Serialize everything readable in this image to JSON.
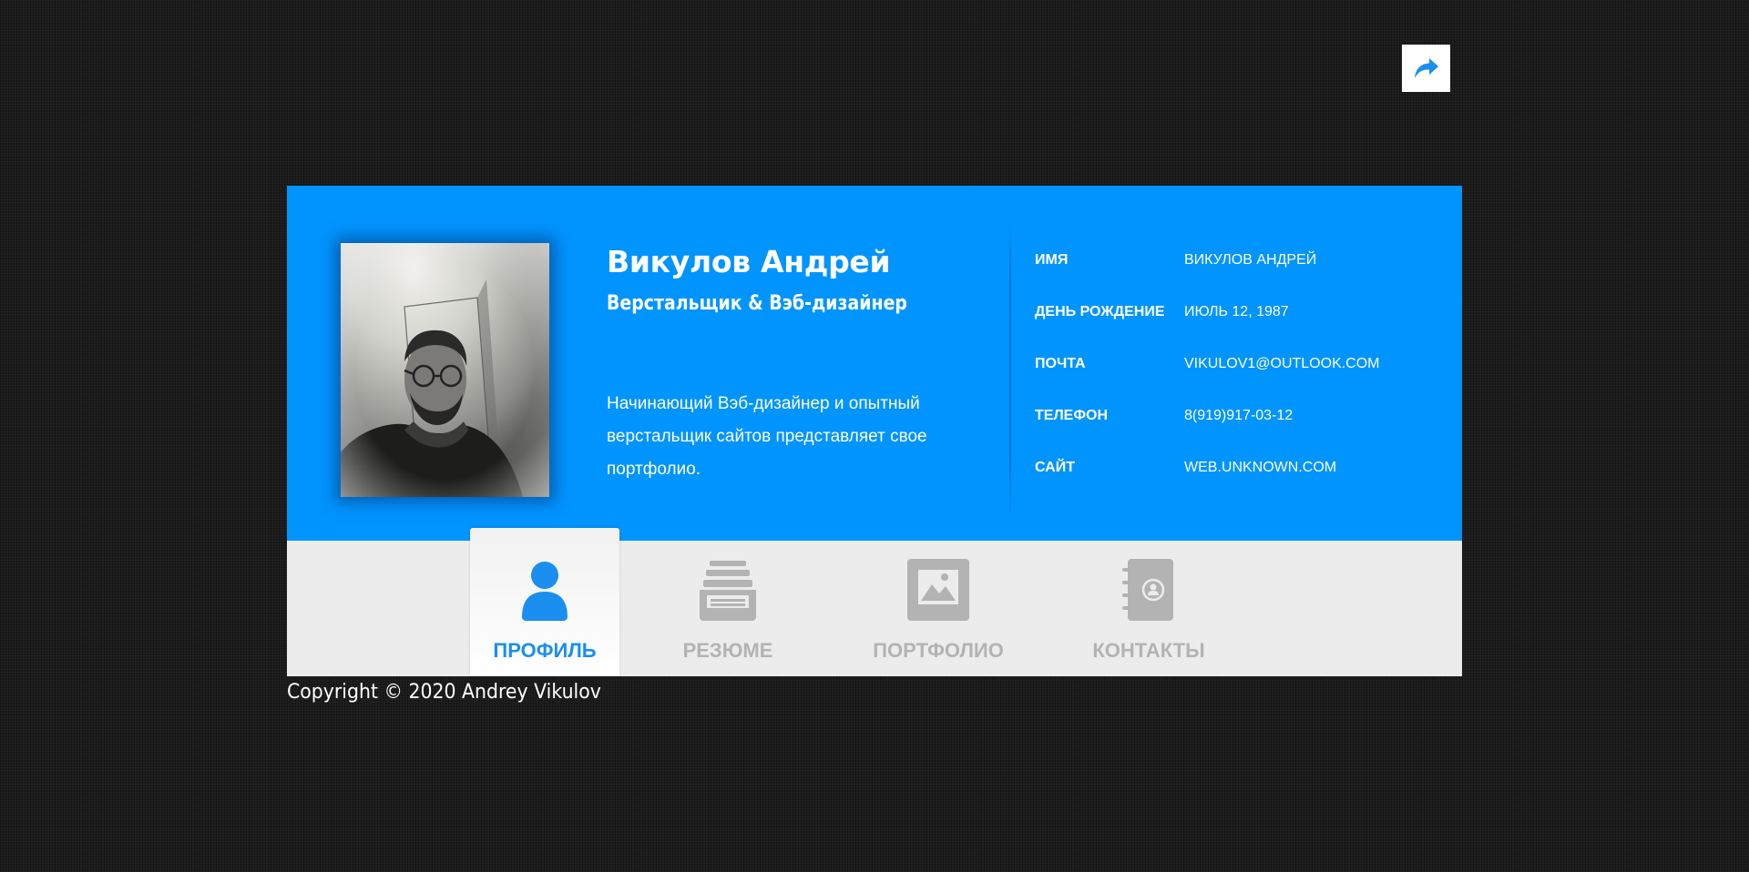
{
  "share": {
    "icon": "share-arrow-icon"
  },
  "profile": {
    "name": "Викулов Андрей",
    "role": "Верстальщик & Вэб-дизайнер",
    "bio": "Начинающий Вэб-дизайнер и опытный верстальщик сайтов представляет свое портфолио.",
    "photo": "portrait-photo"
  },
  "info": [
    {
      "label": "ИМЯ",
      "value": "ВИКУЛОВ АНДРЕЙ"
    },
    {
      "label": "ДЕНЬ РОЖДЕНИЕ",
      "value": "ИЮЛЬ 12, 1987"
    },
    {
      "label": "ПОЧТА",
      "value": "VIKULOV1@OUTLOOK.COM"
    },
    {
      "label": "ТЕЛЕФОН",
      "value": "8(919)917-03-12"
    },
    {
      "label": "САЙТ",
      "value": "WEB.UNKNOWN.COM"
    }
  ],
  "tabs": [
    {
      "label": "ПРОФИЛЬ",
      "icon": "user-icon",
      "active": true
    },
    {
      "label": "РЕЗЮМЕ",
      "icon": "archive-icon",
      "active": false
    },
    {
      "label": "ПОРТФОЛИО",
      "icon": "image-icon",
      "active": false
    },
    {
      "label": "КОНТАКТЫ",
      "icon": "contact-book-icon",
      "active": false
    }
  ],
  "footer": {
    "copyright": "Copyright © 2020 Andrey Vikulov"
  },
  "colors": {
    "accent": "#0094ff",
    "active_tab_text": "#1a8fef",
    "inactive_tab_text": "#b3b3b3",
    "tab_bar": "#ececec"
  }
}
